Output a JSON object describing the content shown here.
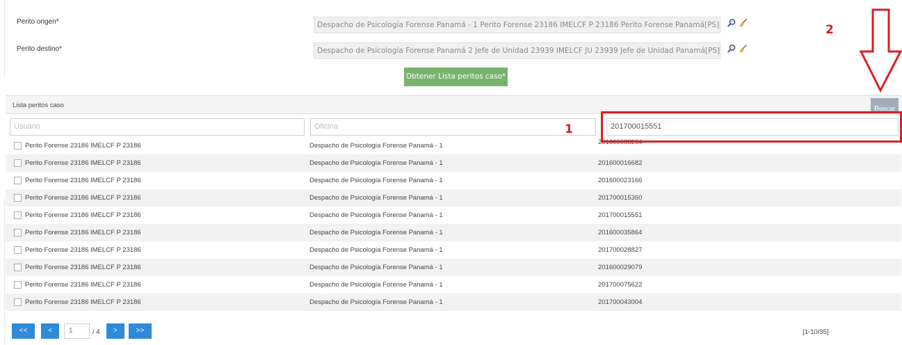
{
  "form": {
    "origin_label": "Perito origen*",
    "origin_value": "Despacho de Psicología Forense Panamá - 1 Perito Forense 23186 IMELCF P 23186 Perito Forense Panamá[PS] / Par",
    "dest_label": "Perito destino*",
    "dest_value": "Despacho de Psicología Forense Panamá 2 Jefe de Unidad 23939 IMELCF JU 23939 Jefe de Unidad Panamá[PS] / Par",
    "obtain_button": "Obtener Lista peritos caso*"
  },
  "panel": {
    "title": "Lista peritos caso",
    "search_button": "Buscar"
  },
  "filters": {
    "user_placeholder": "Usuario",
    "office_placeholder": "Oficina",
    "case_value": "201700015551"
  },
  "rows": [
    {
      "user": "Perito Forense 23186 IMELCF P 23186",
      "office": "Despacho de Psicología Forense Panamá - 1",
      "case": "201600033264"
    },
    {
      "user": "Perito Forense 23186 IMELCF P 23186",
      "office": "Despacho de Psicología Forense Panamá - 1",
      "case": "201600016682"
    },
    {
      "user": "Perito Forense 23186 IMELCF P 23186",
      "office": "Despacho de Psicología Forense Panamá - 1",
      "case": "201600023166"
    },
    {
      "user": "Perito Forense 23186 IMELCF P 23186",
      "office": "Despacho de Psicología Forense Panamá - 1",
      "case": "201700015360"
    },
    {
      "user": "Perito Forense 23186 IMELCF P 23186",
      "office": "Despacho de Psicología Forense Panamá - 1",
      "case": "201700015551"
    },
    {
      "user": "Perito Forense 23186 IMELCF P 23186",
      "office": "Despacho de Psicología Forense Panamá - 1",
      "case": "201600035864"
    },
    {
      "user": "Perito Forense 23186 IMELCF P 23186",
      "office": "Despacho de Psicología Forense Panamá - 1",
      "case": "201700028827"
    },
    {
      "user": "Perito Forense 23186 IMELCF P 23186",
      "office": "Despacho de Psicología Forense Panamá - 1",
      "case": "201600029079"
    },
    {
      "user": "Perito Forense 23186 IMELCF P 23186",
      "office": "Despacho de Psicología Forense Panamá - 1",
      "case": "201700075622"
    },
    {
      "user": "Perito Forense 23186 IMELCF P 23186",
      "office": "Despacho de Psicología Forense Panamá - 1",
      "case": "201700043004"
    }
  ],
  "pager": {
    "first": "<<",
    "prev": "<",
    "page": "1",
    "total": "/ 4",
    "next": ">",
    "last": ">>",
    "range": "[1-10/35]"
  },
  "annotations": {
    "label_1": "1",
    "label_2": "2",
    "color": "#d81e25"
  },
  "colors": {
    "primary_button": "#78b26d",
    "search_button": "#a3acb8",
    "pager_button": "#2f8ad8"
  },
  "icons": {
    "search": "magnifier-icon",
    "clear": "broom-icon"
  }
}
